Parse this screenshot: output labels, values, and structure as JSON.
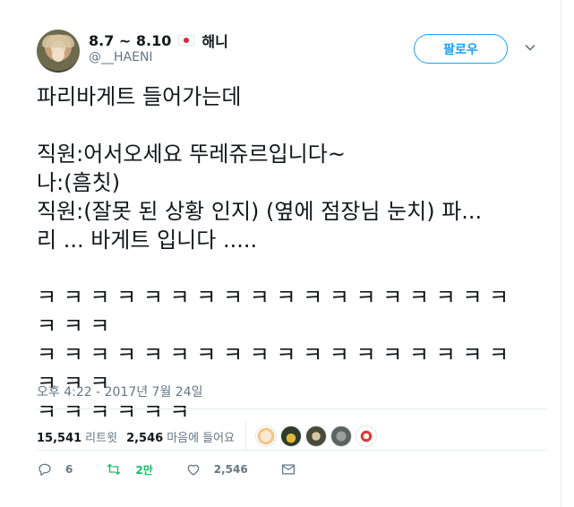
{
  "author": {
    "name_part1": "8.7 ~ 8.10",
    "name_part2": "해니",
    "handle": "@__HAENI"
  },
  "follow_button": "팔로우",
  "tweet": {
    "text": "파리바게트 들어가는데\n\n직원:어서오세요 뚜레쥬르입니다~\n나:(흠칫)\n직원:(잘못 된 상황 인지) (옆에 점장님 눈치) 파...\n리 ... 바게트 입니다 .....\n\nㅋ ㅋ ㅋ ㅋ ㅋ ㅋ ㅋ ㅋ ㅋ ㅋ ㅋ ㅋ ㅋ ㅋ ㅋ ㅋ ㅋ ㅋ ㅋ ㅋ ㅋ\nㅋ ㅋ ㅋ ㅋ ㅋ ㅋ ㅋ ㅋ ㅋ ㅋ ㅋ ㅋ ㅋ ㅋ ㅋ ㅋ ㅋ ㅋ ㅋ ㅋ ㅋ\nㅋ ㅋ ㅋ ㅋ ㅋ ㅋ"
  },
  "timestamp": "오후 4:22 - 2017년 7월 24일",
  "stats": {
    "retweets_count": "15,541",
    "retweets_label": "리트윗",
    "likes_count": "2,546",
    "likes_label": "마음에 들어요"
  },
  "actions": {
    "reply_count": "6",
    "retweet_count": "2만",
    "like_count": "2,546"
  },
  "colors": {
    "accent": "#1da1f2",
    "retweet_green": "#17bf63",
    "muted": "#657786"
  },
  "icons": {
    "flag": "japan-flag-icon",
    "caret": "chevron-down-icon",
    "reply": "reply-icon",
    "retweet": "retweet-icon",
    "like": "heart-icon",
    "dm": "envelope-icon"
  }
}
